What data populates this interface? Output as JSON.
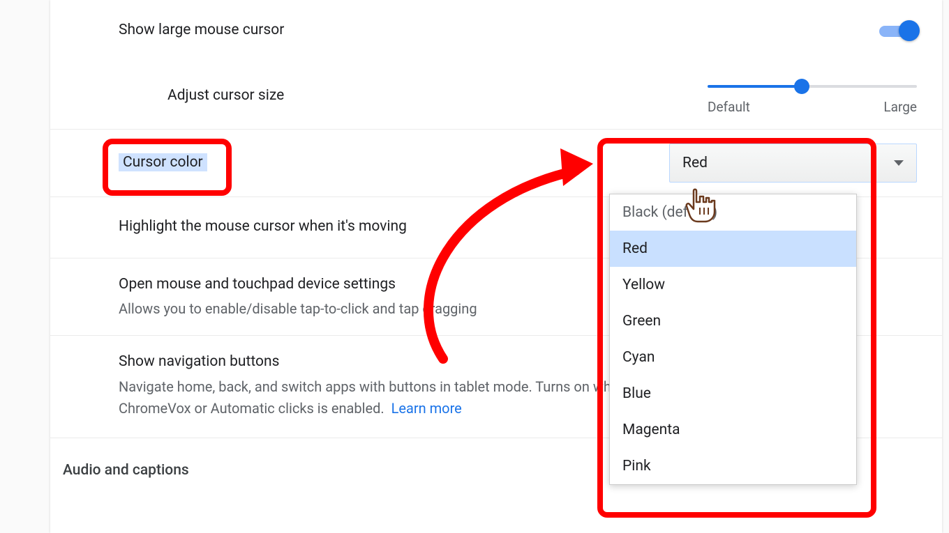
{
  "rows": {
    "large_cursor": {
      "label": "Show large mouse cursor",
      "toggle": true
    },
    "adjust_size": {
      "label": "Adjust cursor size",
      "min_label": "Default",
      "max_label": "Large"
    },
    "cursor_color": {
      "label": "Cursor color",
      "selected": "Red",
      "options": [
        "Black (default)",
        "Red",
        "Yellow",
        "Green",
        "Cyan",
        "Blue",
        "Magenta",
        "Pink"
      ]
    },
    "highlight_moving": {
      "label": "Highlight the mouse cursor when it's moving"
    },
    "open_touchpad": {
      "label": "Open mouse and touchpad device settings",
      "sub": "Allows you to enable/disable tap-to-click and tap dragging"
    },
    "nav_buttons": {
      "label": "Show navigation buttons",
      "sub": "Navigate home, back, and switch apps with buttons in tablet mode. Turns on when ChromeVox or Automatic clicks is enabled.",
      "learn_more": "Learn more"
    }
  },
  "section_header": "Audio and captions"
}
